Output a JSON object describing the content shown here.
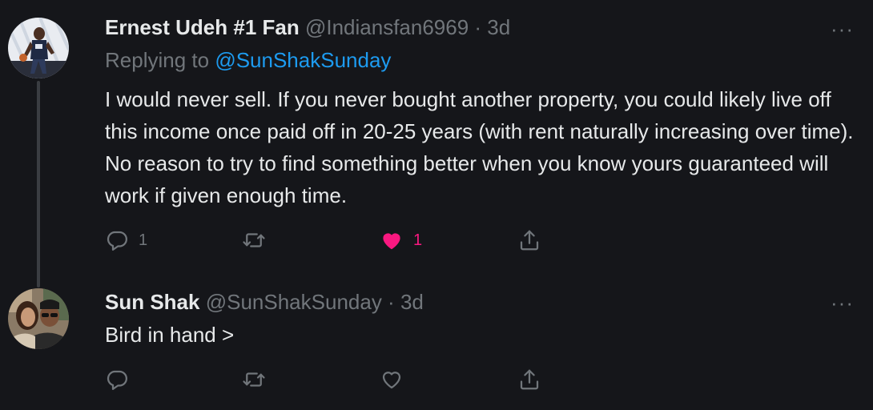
{
  "tweets": [
    {
      "name": "Ernest Udeh #1 Fan",
      "handle": "@Indiansfan6969",
      "separator": " · ",
      "time": "3d",
      "replying_label": "Replying to ",
      "replying_handle": "@SunShakSunday",
      "text": "I would never sell. If you never bought another property, you could likely live off this income once paid off in 20-25 years (with rent naturally increasing over time). No reason to try to find something better when you know yours guaranteed will work if given enough time.",
      "reply_count": "1",
      "like_count": "1",
      "liked": true
    },
    {
      "name": "Sun Shak",
      "handle": "@SunShakSunday",
      "separator": " · ",
      "time": "3d",
      "text": "Bird in hand >",
      "liked": false
    }
  ],
  "more_label": "···",
  "colors": {
    "background": "#15161a",
    "text": "#e7e9ea",
    "muted": "#71767b",
    "accent": "#1d9bf0",
    "like": "#f91880"
  },
  "icons": [
    "reply-icon",
    "retweet-icon",
    "like-icon",
    "share-icon",
    "more-icon"
  ]
}
